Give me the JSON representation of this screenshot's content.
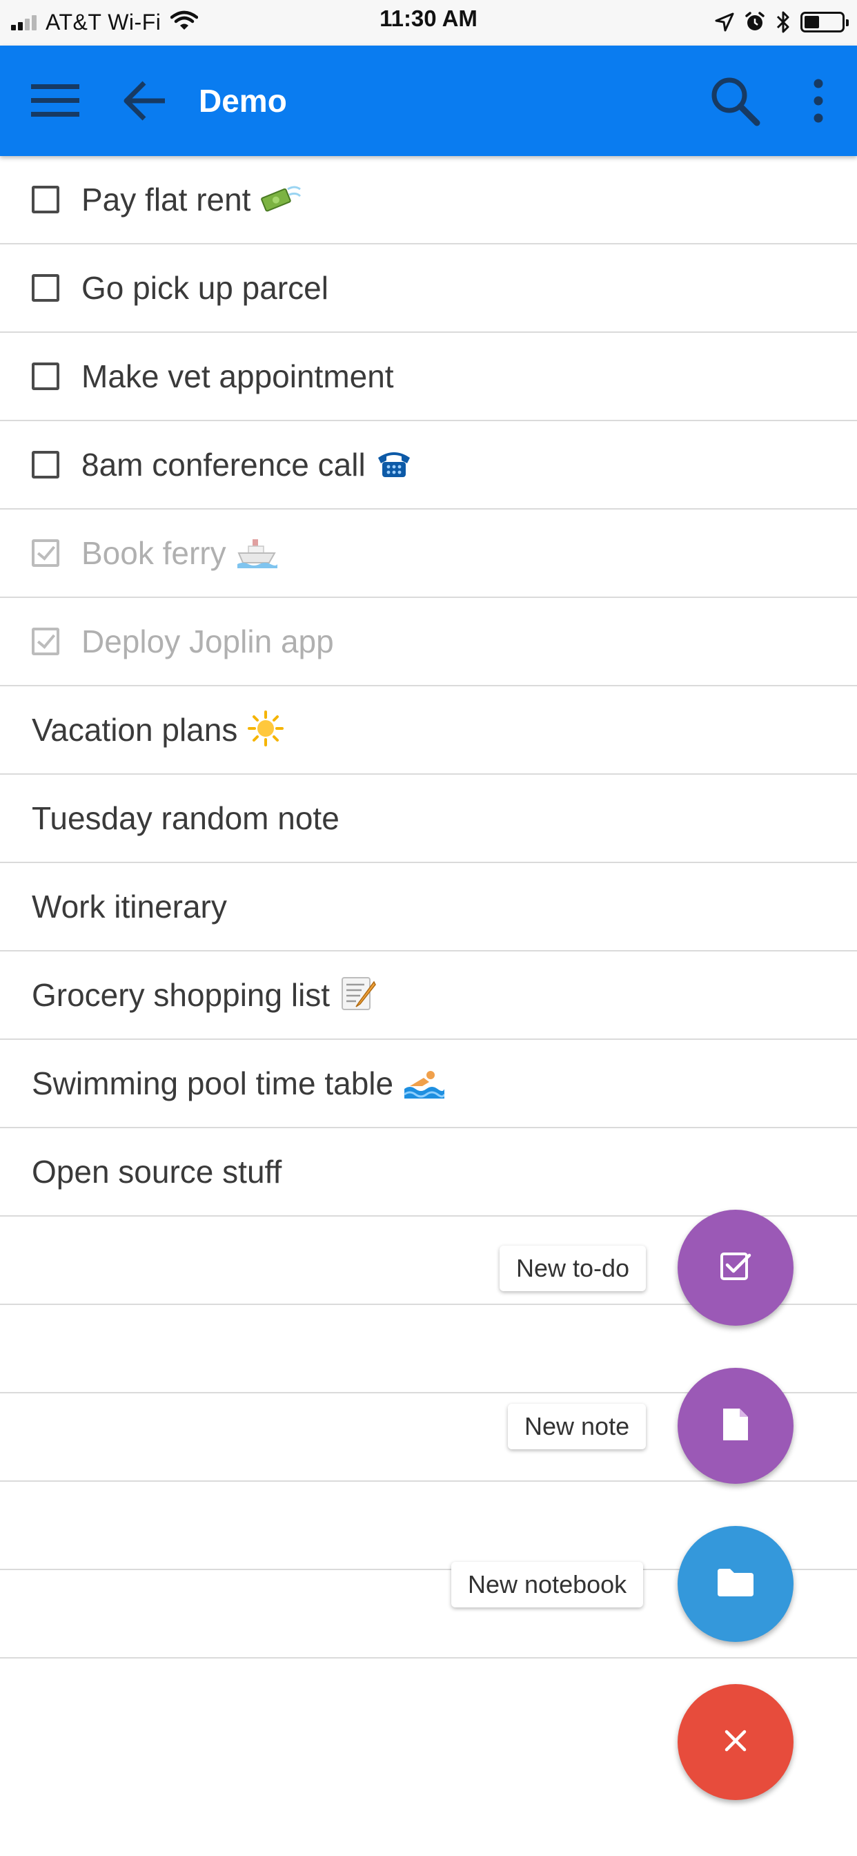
{
  "status_bar": {
    "carrier": "AT&T Wi-Fi",
    "time": "11:30 AM",
    "battery_level": 0.4
  },
  "app_bar": {
    "title": "Demo",
    "background": "#0a7cf0",
    "icons": [
      "menu-icon",
      "back-arrow-icon",
      "search-icon",
      "more-vert-icon"
    ]
  },
  "items": [
    {
      "type": "todo",
      "done": false,
      "title": "Pay flat rent",
      "emoji": "money-with-wings"
    },
    {
      "type": "todo",
      "done": false,
      "title": "Go pick up parcel"
    },
    {
      "type": "todo",
      "done": false,
      "title": "Make vet appointment"
    },
    {
      "type": "todo",
      "done": false,
      "title": "8am conference call",
      "emoji": "telephone"
    },
    {
      "type": "todo",
      "done": true,
      "title": "Book ferry",
      "emoji": "ship"
    },
    {
      "type": "todo",
      "done": true,
      "title": "Deploy Joplin app"
    },
    {
      "type": "note",
      "title": "Vacation plans",
      "emoji": "sun"
    },
    {
      "type": "note",
      "title": "Tuesday random note"
    },
    {
      "type": "note",
      "title": "Work itinerary"
    },
    {
      "type": "note",
      "title": "Grocery shopping list",
      "emoji": "memo"
    },
    {
      "type": "note",
      "title": "Swimming pool time table",
      "emoji": "swimmer"
    },
    {
      "type": "note",
      "title": "Open source stuff"
    }
  ],
  "fab_menu": {
    "new_todo": {
      "label": "New to-do",
      "color": "#9b59b6",
      "icon": "checkbox-icon"
    },
    "new_note": {
      "label": "New note",
      "color": "#9b59b6",
      "icon": "document-icon"
    },
    "new_notebook": {
      "label": "New notebook",
      "color": "#3498db",
      "icon": "folder-icon"
    },
    "close": {
      "color": "#e74c3c",
      "icon": "close-icon"
    }
  }
}
